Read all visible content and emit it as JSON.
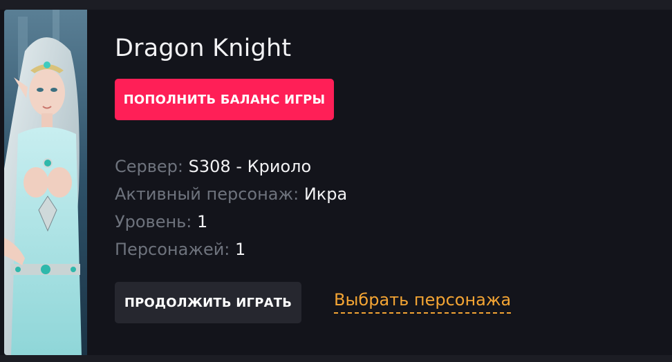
{
  "game": {
    "title": "Dragon Knight",
    "topup_label": "ПОПОЛНИТЬ БАЛАНС ИГРЫ",
    "art_icon": "elf-character-art"
  },
  "info": {
    "server_label": "Сервер:",
    "server_value": "S308 - Криоло",
    "character_label": "Активный персонаж:",
    "character_value": "Икра",
    "level_label": "Уровень:",
    "level_value": "1",
    "characters_label": "Персонажей:",
    "characters_value": "1"
  },
  "actions": {
    "continue_label": "ПРОДОЛЖИТЬ ИГРАТЬ",
    "choose_label": "Выбрать персонажа"
  },
  "colors": {
    "accent": "#ff1f57",
    "link": "#f4a534",
    "background": "#13141b"
  }
}
